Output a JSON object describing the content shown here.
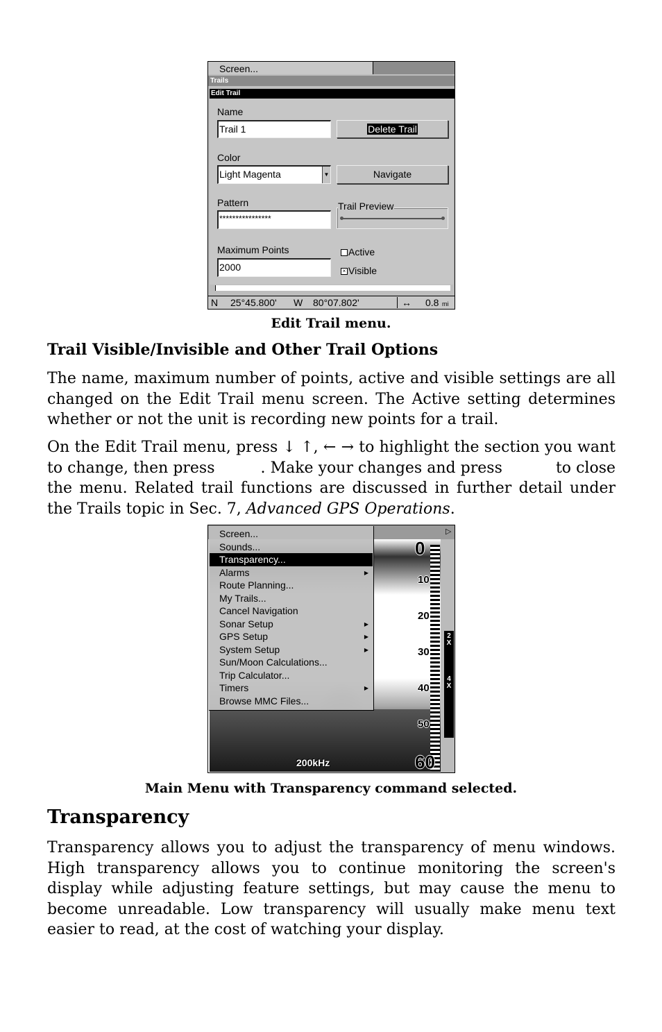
{
  "screenshot1": {
    "top_menu_item": "Screen...",
    "trails_bar": "Trails",
    "edit_trail_bar": "Edit Trail",
    "name_label": "Name",
    "name_value": "Trail 1",
    "delete_button": "Delete Trail",
    "color_label": "Color",
    "color_value": "Light Magenta",
    "navigate_button": "Navigate",
    "pattern_label": "Pattern",
    "pattern_value": "****************",
    "preview_label": "Trail Preview",
    "max_points_label": "Maximum Points",
    "max_points_value": "2000",
    "active_label": "Active",
    "active_checked": false,
    "visible_label": "Visible",
    "visible_checked": true,
    "status": {
      "lat_hem": "N",
      "lat": "25°45.800'",
      "lon_hem": "W",
      "lon": "80°07.802'",
      "range_icon": "double-arrow",
      "range": "0.8",
      "unit": "mi"
    }
  },
  "caption1": "Edit Trail menu.",
  "section1_heading": "Trail Visible/Invisible and Other Trail Options",
  "para1": "The name, maximum number of points, active and visible settings are all changed on the Edit Trail menu screen. The Active setting determines whether or not the unit is recording new points for a trail.",
  "para2": {
    "a": "On the Edit Trail menu, press ↓ ↑, ← →  to highlight the section you want to change, then press",
    "b": ". Make your changes and press",
    "c": "to close the menu. Related trail functions are discussed in further detail under the Trails topic in Sec. 7,",
    "italic": "Advanced GPS Operations",
    "d": "."
  },
  "screenshot2": {
    "menu_items": [
      {
        "label": "Screen...",
        "submenu": false
      },
      {
        "label": "Sounds...",
        "submenu": false
      },
      {
        "label": "Transparency...",
        "submenu": false,
        "selected": true
      },
      {
        "label": "Alarms",
        "submenu": true
      },
      {
        "label": "Route Planning...",
        "submenu": false
      },
      {
        "label": "My Trails...",
        "submenu": false
      },
      {
        "label": "Cancel Navigation",
        "submenu": false
      },
      {
        "label": "Sonar Setup",
        "submenu": true
      },
      {
        "label": "GPS Setup",
        "submenu": true
      },
      {
        "label": "System Setup",
        "submenu": true
      },
      {
        "label": "Sun/Moon Calculations...",
        "submenu": false
      },
      {
        "label": "Trip Calculator...",
        "submenu": false
      },
      {
        "label": "Timers",
        "submenu": true
      },
      {
        "label": "Browse MMC Files...",
        "submenu": false
      }
    ],
    "depth_scale": [
      "0",
      "10",
      "20",
      "30",
      "40",
      "50",
      "60"
    ],
    "zoom_2x": "2X",
    "zoom_4x": "4X",
    "frequency": "200kHz"
  },
  "caption2": "Main Menu with Transparency command selected.",
  "section2_heading": "Transparency",
  "para3": "Transparency allows you to adjust the transparency of menu windows. High transparency allows you to continue monitoring the screen's display while adjusting feature settings, but may cause the menu to become unreadable. Low transparency will usually make menu text easier to read, at the cost of watching your display."
}
